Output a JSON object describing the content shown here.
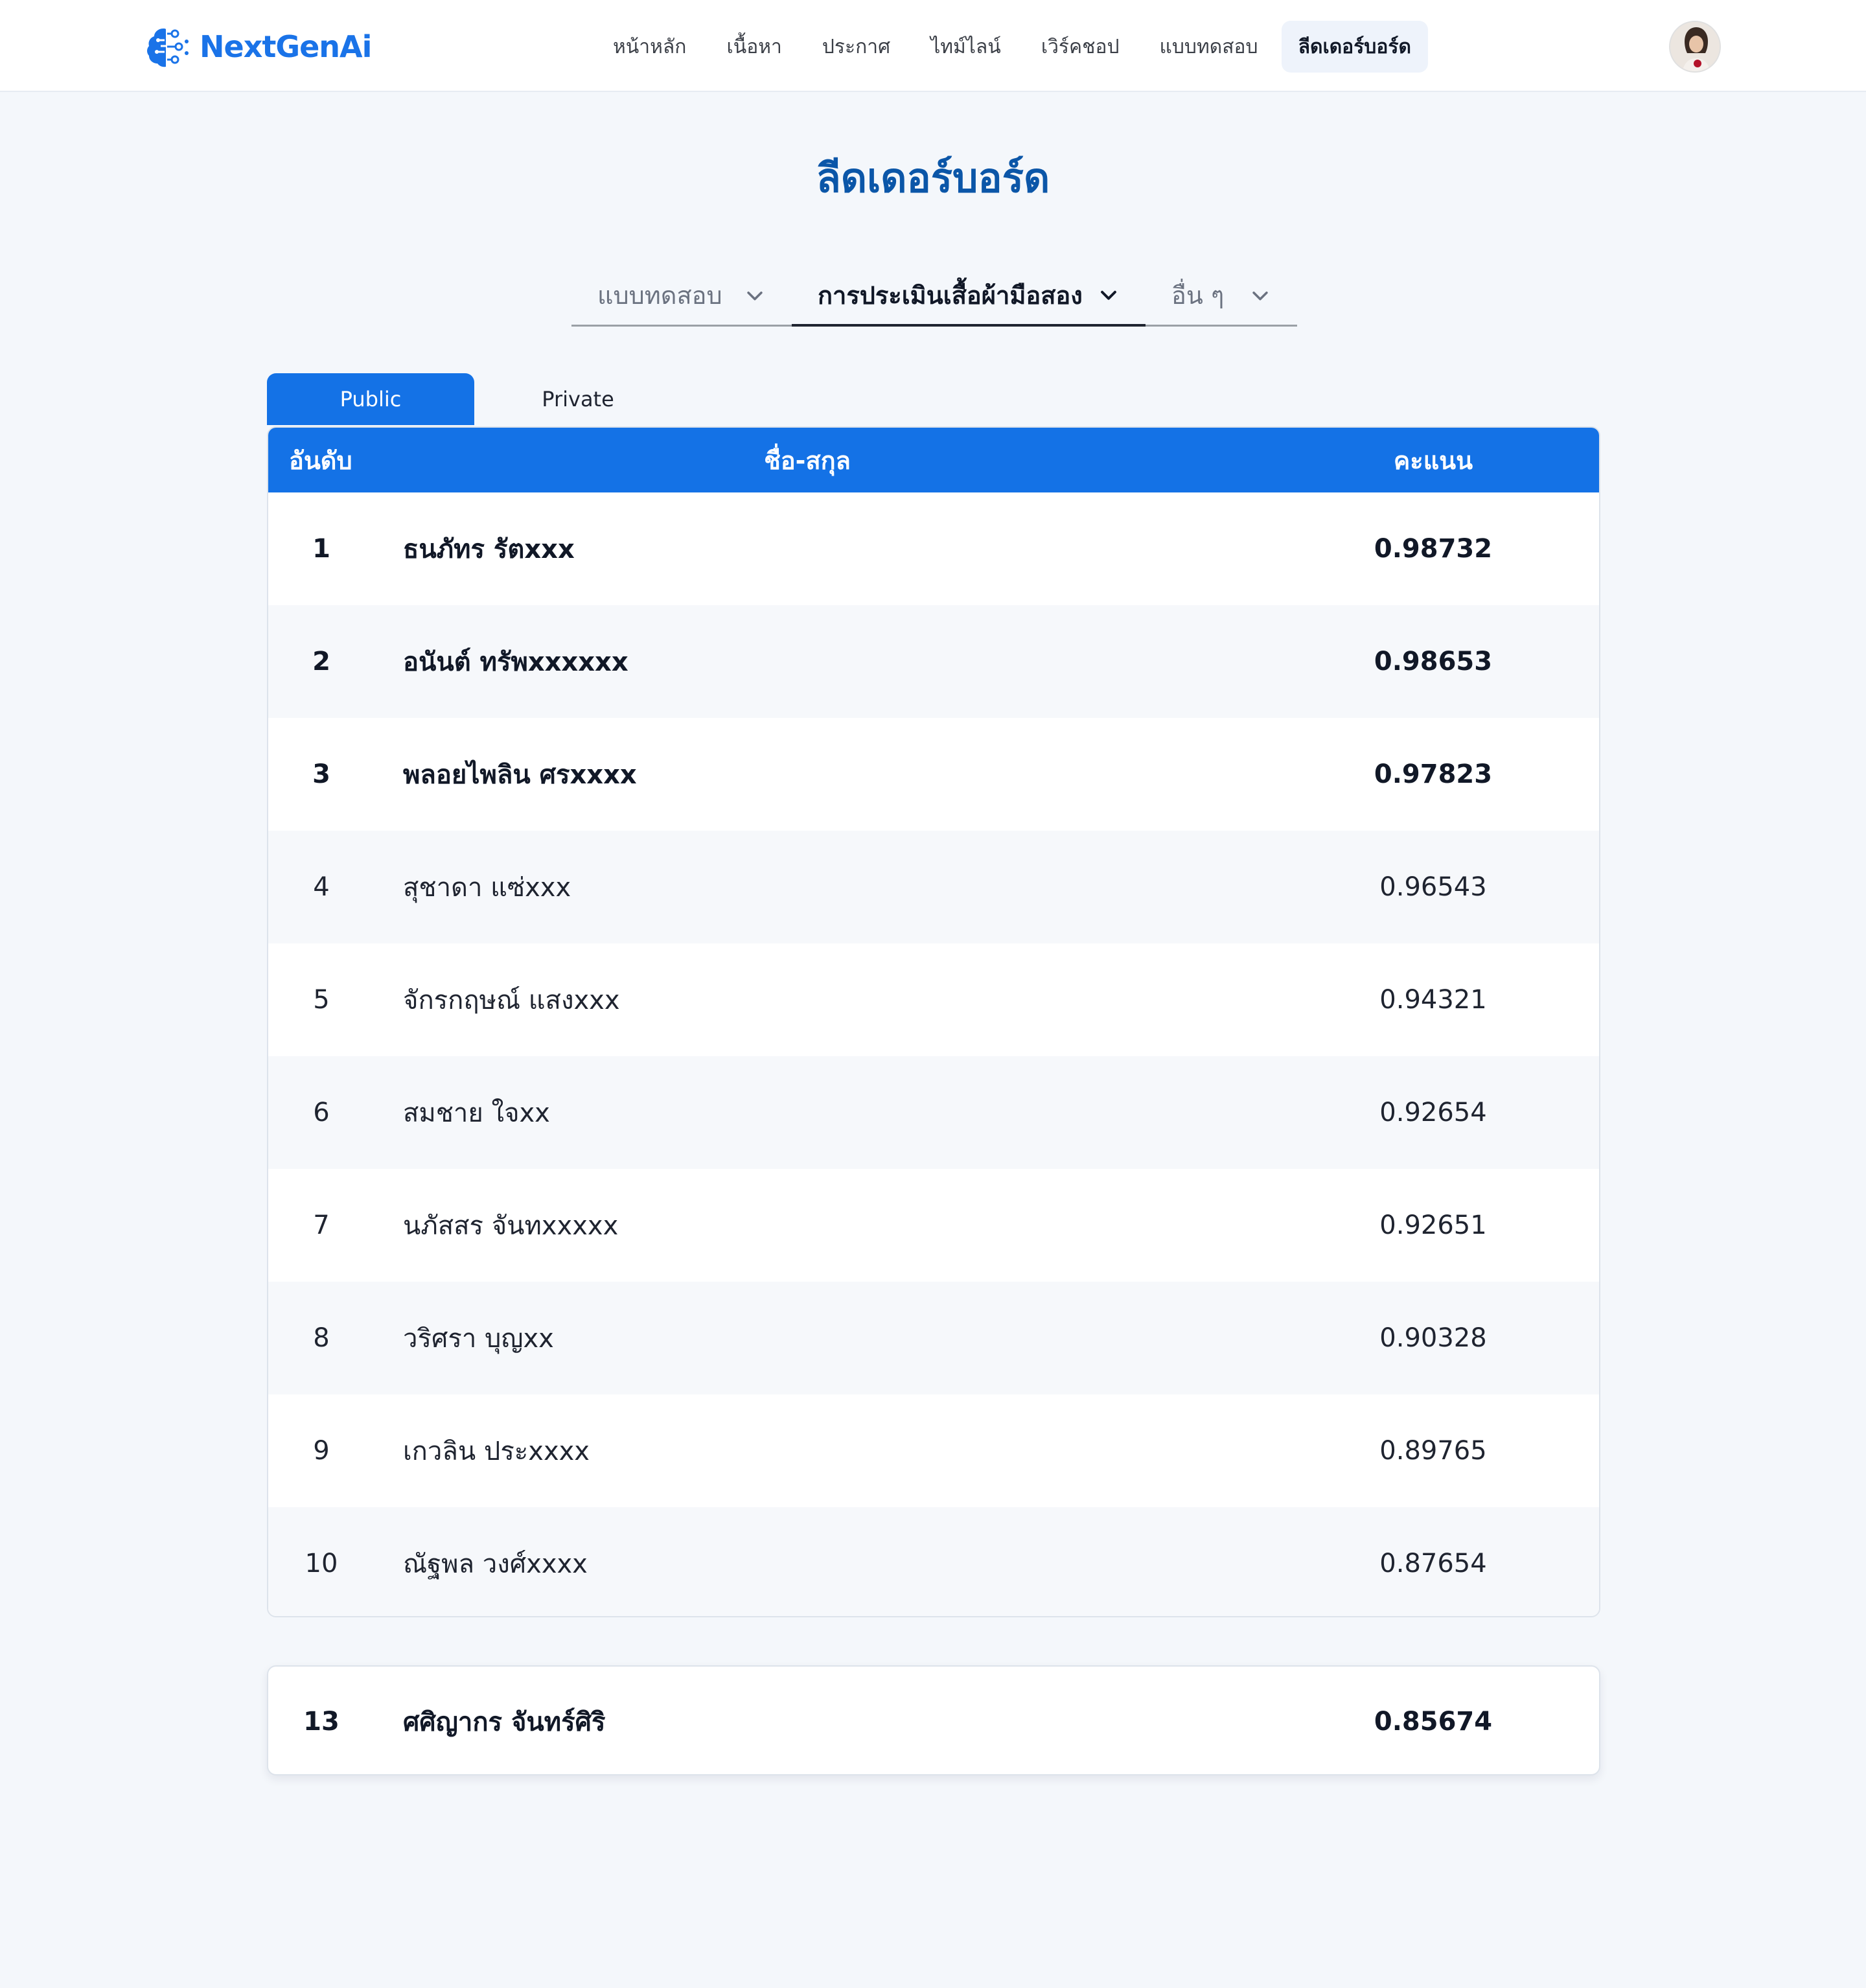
{
  "header": {
    "logo_text": "NextGenAi",
    "nav": [
      {
        "label": "หน้าหลัก"
      },
      {
        "label": "เนื้อหา"
      },
      {
        "label": "ประกาศ"
      },
      {
        "label": "ไทม์ไลน์"
      },
      {
        "label": "เวิร์คชอป"
      },
      {
        "label": "แบบทดสอบ"
      },
      {
        "label": "ลีดเดอร์บอร์ด",
        "active": true
      }
    ]
  },
  "page_title": "ลีดเดอร์บอร์ด",
  "filters": [
    {
      "label": "แบบทดสอบ"
    },
    {
      "label": "การประเมินเสื้อผ้ามือสอง",
      "active": true
    },
    {
      "label": "อื่น ๆ"
    }
  ],
  "tabs": [
    {
      "label": "Public",
      "active": true
    },
    {
      "label": "Private"
    }
  ],
  "table": {
    "headers": {
      "rank": "อันดับ",
      "name": "ชื่อ-สกุล",
      "score": "คะแนน"
    },
    "rows": [
      {
        "rank": "1",
        "name": "ธนภัทร รัตxxx",
        "score": "0.98732"
      },
      {
        "rank": "2",
        "name": "อนันต์ ทรัพxxxxxx",
        "score": "0.98653"
      },
      {
        "rank": "3",
        "name": "พลอยไพลิน ศรxxxx",
        "score": "0.97823"
      },
      {
        "rank": "4",
        "name": "สุชาดา แซ่xxx",
        "score": "0.96543"
      },
      {
        "rank": "5",
        "name": "จักรกฤษณ์ แสงxxx",
        "score": "0.94321"
      },
      {
        "rank": "6",
        "name": "สมชาย ใจxx",
        "score": "0.92654"
      },
      {
        "rank": "7",
        "name": "นภัสสร จันทxxxxx",
        "score": "0.92651"
      },
      {
        "rank": "8",
        "name": "วริศรา บุญxx",
        "score": "0.90328"
      },
      {
        "rank": "9",
        "name": "เกวลิน ประxxxx",
        "score": "0.89765"
      },
      {
        "rank": "10",
        "name": "ณัฐพล วงศ์xxxx",
        "score": "0.87654"
      }
    ]
  },
  "my_rank": {
    "rank": "13",
    "name": "ศศิญากร จันทร์ศิริ",
    "score": "0.85674"
  },
  "colors": {
    "primary": "#1472e6",
    "title": "#0b56a8",
    "background": "#f4f7fb"
  }
}
